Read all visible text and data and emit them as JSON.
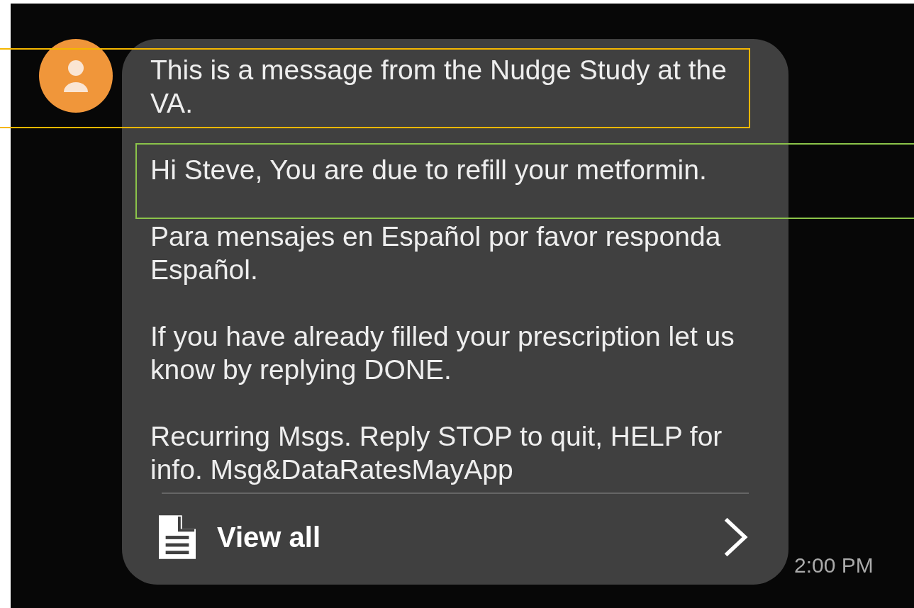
{
  "message": {
    "paragraphs": [
      "This is a message from the Nudge Study at the VA.",
      "Hi Steve, You are due to refill your metformin.",
      "Para mensajes en Español por favor responda Español.",
      "If you have already filled your prescription let us know by replying DONE.",
      "Recurring Msgs. Reply STOP to quit, HELP for info. Msg&DataRatesMayApp"
    ],
    "action": "View all",
    "time": "2:00 PM"
  },
  "highlights": [
    {
      "kind": "box",
      "color": "#f5b700"
    },
    {
      "kind": "box",
      "color": "#8bc34a"
    }
  ]
}
